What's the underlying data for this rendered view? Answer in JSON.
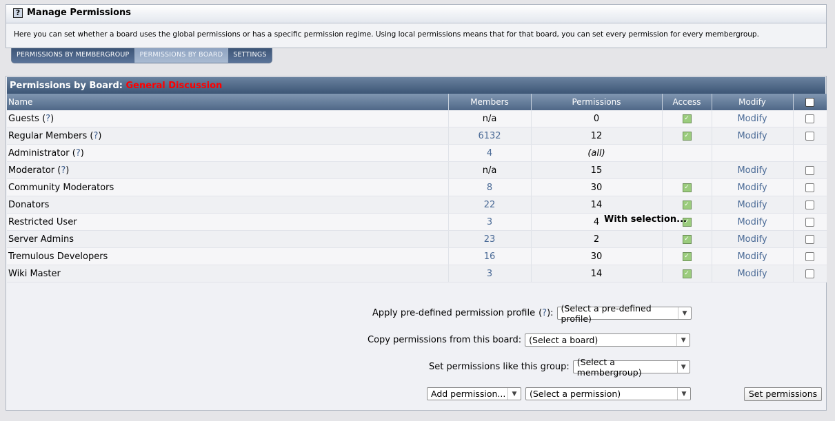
{
  "header": {
    "help_glyph": "?",
    "title": "Manage Permissions",
    "description": "Here you can set whether a board uses the global permissions or has a specific permission regime. Using local permissions means that for that board, you can set every permission for every membergroup."
  },
  "tabs": [
    {
      "label": "PERMISSIONS BY MEMBERGROUP",
      "active": false
    },
    {
      "label": "PERMISSIONS BY BOARD",
      "active": true
    },
    {
      "label": "SETTINGS",
      "active": false
    }
  ],
  "panel": {
    "title_prefix": "Permissions by Board:",
    "board_name": "General Discussion",
    "board_color": "#ff0000"
  },
  "columns": {
    "name": "Name",
    "members": "Members",
    "permissions": "Permissions",
    "access": "Access",
    "modify": "Modify"
  },
  "rows": [
    {
      "name": "Guests",
      "help": "?",
      "members": "n/a",
      "members_link": false,
      "permissions": "0",
      "access": true,
      "modify": "Modify",
      "checkbox": true
    },
    {
      "name": "Regular Members",
      "help": "?",
      "members": "6132",
      "members_link": true,
      "permissions": "12",
      "access": true,
      "modify": "Modify",
      "checkbox": true
    },
    {
      "name": "Administrator",
      "help": "?",
      "members": "4",
      "members_link": true,
      "permissions": "(all)",
      "access": false,
      "modify": "",
      "checkbox": false
    },
    {
      "name": "Moderator",
      "help": "?",
      "members": "n/a",
      "members_link": false,
      "permissions": "15",
      "access": false,
      "modify": "Modify",
      "checkbox": true
    },
    {
      "name": "Community Moderators",
      "help": "",
      "members": "8",
      "members_link": true,
      "permissions": "30",
      "access": true,
      "modify": "Modify",
      "checkbox": true
    },
    {
      "name": "Donators",
      "help": "",
      "members": "22",
      "members_link": true,
      "permissions": "14",
      "access": true,
      "modify": "Modify",
      "checkbox": true
    },
    {
      "name": "Restricted User",
      "help": "",
      "members": "3",
      "members_link": true,
      "permissions": "4",
      "access": true,
      "modify": "Modify",
      "checkbox": true
    },
    {
      "name": "Server Admins",
      "help": "",
      "members": "23",
      "members_link": true,
      "permissions": "2",
      "access": true,
      "modify": "Modify",
      "checkbox": true
    },
    {
      "name": "Tremulous Developers",
      "help": "",
      "members": "16",
      "members_link": true,
      "permissions": "30",
      "access": true,
      "modify": "Modify",
      "checkbox": true
    },
    {
      "name": "Wiki Master",
      "help": "",
      "members": "3",
      "members_link": true,
      "permissions": "14",
      "access": true,
      "modify": "Modify",
      "checkbox": true
    }
  ],
  "selection": {
    "heading": "With selection...",
    "profile_label": "Apply pre-defined permission profile",
    "profile_help": "?",
    "profile_select": "(Select a pre-defined profile)",
    "copy_label": "Copy permissions from this board:",
    "copy_select": "(Select a board)",
    "like_label": "Set permissions like this group:",
    "like_select": "(Select a membergroup)",
    "add_select": "Add permission...",
    "perm_select": "(Select a permission)",
    "submit_label": "Set permissions"
  },
  "colors": {
    "accent": "#3d5676",
    "link": "#4a6a96",
    "access_ok": "#9bcc7d"
  }
}
